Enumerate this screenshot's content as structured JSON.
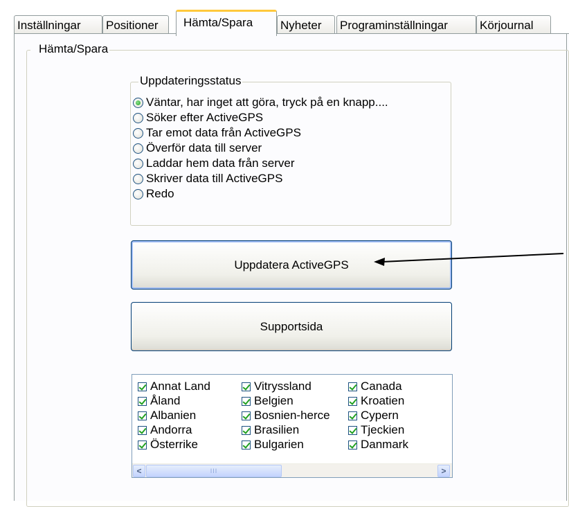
{
  "tabs": [
    {
      "label": "Inställningar",
      "active": false
    },
    {
      "label": "Positioner",
      "active": false
    },
    {
      "label": "Hämta/Spara",
      "active": true
    },
    {
      "label": "Nyheter",
      "active": false
    },
    {
      "label": "Programinställningar",
      "active": false
    },
    {
      "label": "Körjournal",
      "active": false
    }
  ],
  "outer_group": {
    "title": "Hämta/Spara"
  },
  "status_group": {
    "title": "Uppdateringsstatus",
    "options": [
      {
        "label": "Väntar, har inget att göra, tryck på en knapp....",
        "checked": true
      },
      {
        "label": "Söker efter ActiveGPS",
        "checked": false
      },
      {
        "label": "Tar emot data från ActiveGPS",
        "checked": false
      },
      {
        "label": "Överför data till server",
        "checked": false
      },
      {
        "label": "Laddar hem data från server",
        "checked": false
      },
      {
        "label": "Skriver data till ActiveGPS",
        "checked": false
      },
      {
        "label": "Redo",
        "checked": false
      }
    ]
  },
  "buttons": {
    "update": "Uppdatera ActiveGPS",
    "support": "Supportsida"
  },
  "countries": [
    [
      "Annat Land",
      "Vitryssland",
      "Canada"
    ],
    [
      "Åland",
      "Belgien",
      "Kroatien"
    ],
    [
      "Albanien",
      "Bosnien-herce",
      "Cypern"
    ],
    [
      "Andorra",
      "Brasilien",
      "Tjeckien"
    ],
    [
      "Österrike",
      "Bulgarien",
      "Danmark"
    ]
  ],
  "scrollbar": {
    "left_arrow": "<",
    "right_arrow": ">",
    "thumb_grip": "III"
  },
  "colors": {
    "active_tab_accent": "#ffc83c",
    "button_border": "#003c74",
    "radio_check": "#21a121",
    "annotation_arrow": "#000000"
  }
}
